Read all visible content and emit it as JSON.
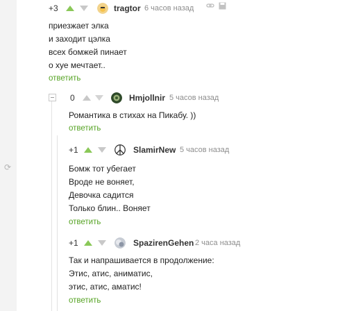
{
  "comments": [
    {
      "rating": "+3",
      "user": "tragtor",
      "time": "6 часов назад",
      "lines": [
        "приезжает элка",
        "и заходит цэлка",
        "всех бомжей пинает",
        "о хуе мечтает.."
      ],
      "reply": "ответить"
    },
    {
      "rating": "0",
      "user": "Hmjollnir",
      "time": "5 часов назад",
      "lines": [
        "Романтика в стихах на Пикабу. ))"
      ],
      "reply": "ответить"
    },
    {
      "rating": "+1",
      "user": "SlamirNew",
      "time": "5 часов назад",
      "lines": [
        "Бомж тот убегает",
        "Вроде не воняет,",
        "Девочка садится",
        "Только блин.. Воняет"
      ],
      "reply": "ответить"
    },
    {
      "rating": "+1",
      "user": "SpazirenGehen",
      "time": "2 часа назад",
      "lines": [
        "Так и напрашивается в продолжение:",
        "Этис, атис, аниматис,",
        "этис, атис, аматис!"
      ],
      "reply": "ответить"
    }
  ],
  "icons": {
    "upvote": "triangle-up-icon",
    "downvote": "triangle-down-icon",
    "link": "link-icon",
    "save": "save-icon",
    "collapse": "collapse-minus-icon",
    "refresh": "refresh-icon"
  },
  "colors": {
    "upvote": "#8ac858",
    "reply": "#56a324",
    "meta": "#8e8e8e"
  }
}
